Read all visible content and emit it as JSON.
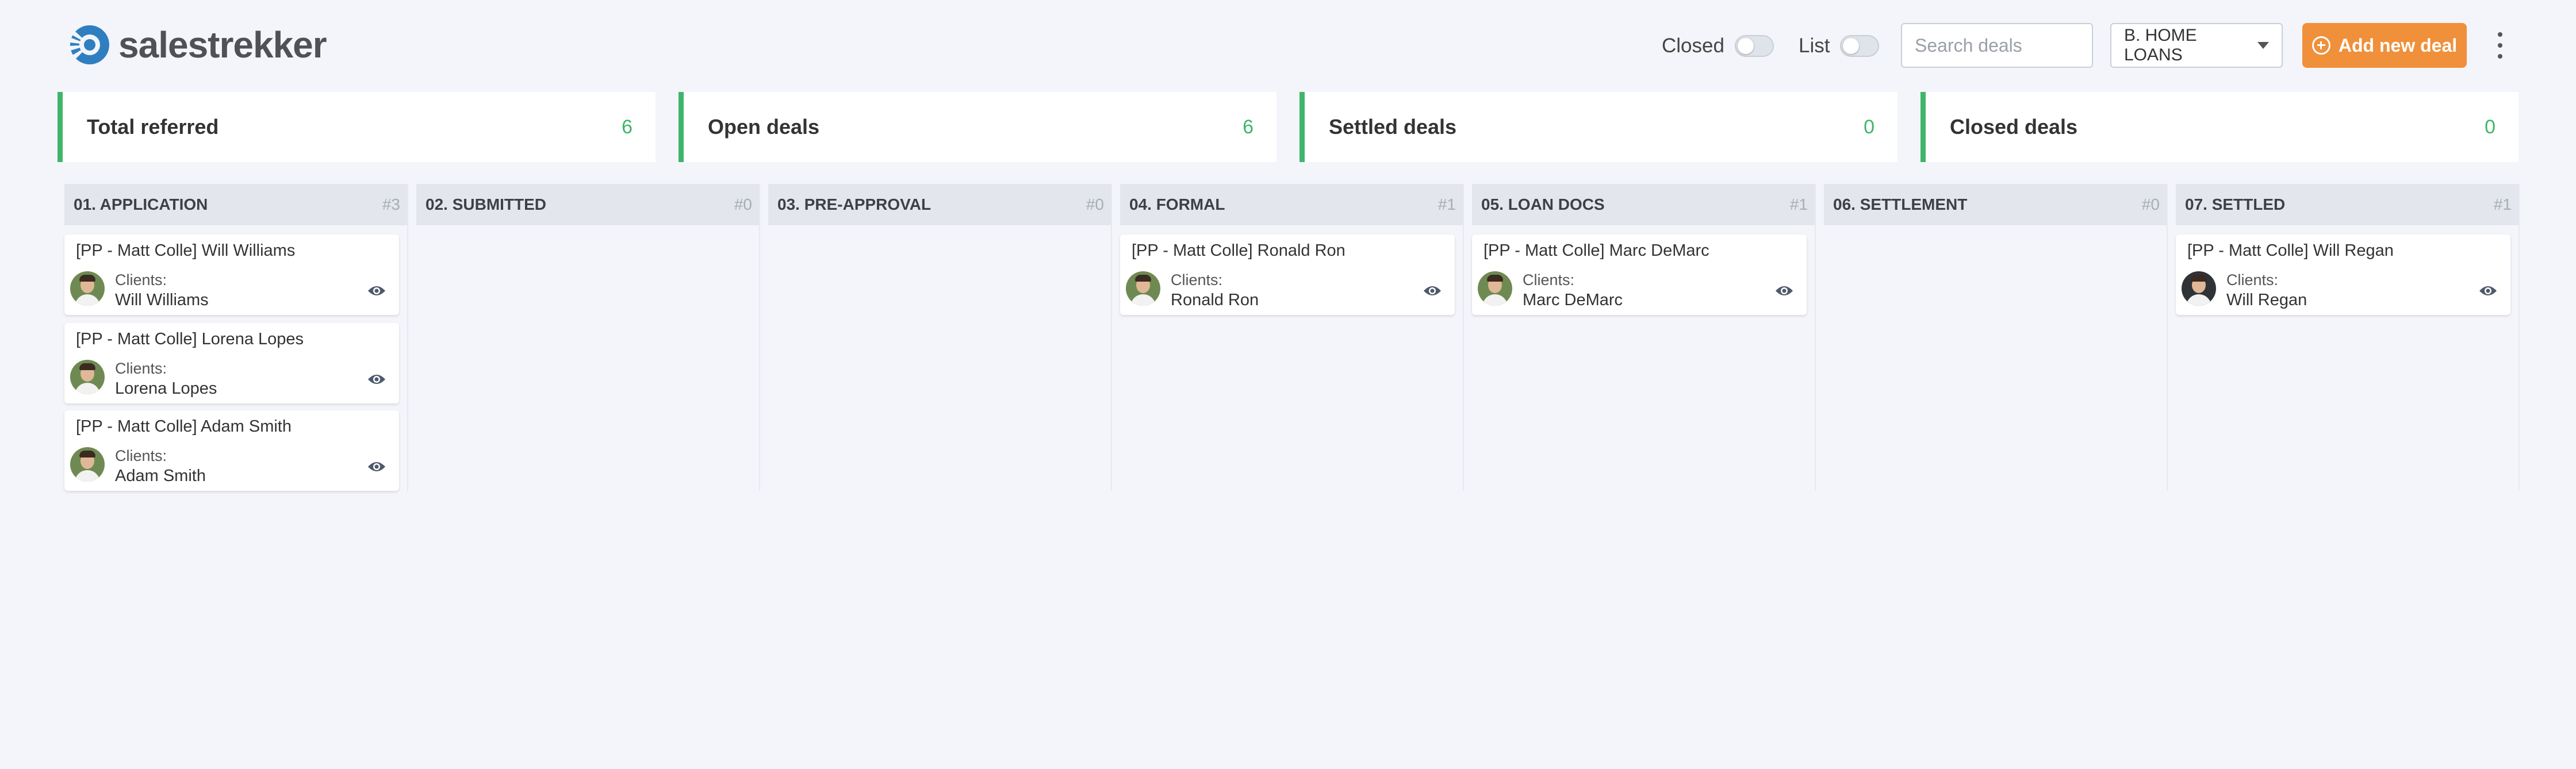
{
  "header": {
    "logo_text": "salestrekker",
    "closed_toggle": {
      "label": "Closed",
      "on": false
    },
    "list_toggle": {
      "label": "List",
      "on": false
    },
    "search": {
      "placeholder": "Search deals",
      "value": ""
    },
    "pipeline_select": {
      "value": "B. HOME LOANS"
    },
    "add_button_label": "Add new deal",
    "brand_color": "#f0903a"
  },
  "stats": [
    {
      "label": "Total referred",
      "value": "6"
    },
    {
      "label": "Open deals",
      "value": "6"
    },
    {
      "label": "Settled deals",
      "value": "0"
    },
    {
      "label": "Closed deals",
      "value": "0"
    }
  ],
  "columns": [
    {
      "title": "01. APPLICATION",
      "count": "#3",
      "deals": [
        {
          "title": "[PP - Matt Colle] Will Williams",
          "clients_label": "Clients:",
          "client": "Will Williams"
        },
        {
          "title": "[PP - Matt Colle] Lorena Lopes",
          "clients_label": "Clients:",
          "client": "Lorena Lopes"
        },
        {
          "title": "[PP - Matt Colle] Adam Smith",
          "clients_label": "Clients:",
          "client": "Adam Smith"
        }
      ]
    },
    {
      "title": "02. SUBMITTED",
      "count": "#0",
      "deals": []
    },
    {
      "title": "03. PRE-APPROVAL",
      "count": "#0",
      "deals": []
    },
    {
      "title": "04. FORMAL",
      "count": "#1",
      "deals": [
        {
          "title": "[PP - Matt Colle] Ronald Ron",
          "clients_label": "Clients:",
          "client": "Ronald Ron"
        }
      ]
    },
    {
      "title": "05. LOAN DOCS",
      "count": "#1",
      "deals": [
        {
          "title": "[PP - Matt Colle] Marc DeMarc",
          "clients_label": "Clients:",
          "client": "Marc DeMarc"
        }
      ]
    },
    {
      "title": "06. SETTLEMENT",
      "count": "#0",
      "deals": []
    },
    {
      "title": "07. SETTLED",
      "count": "#1",
      "deals": [
        {
          "title": "[PP - Matt Colle] Will Regan",
          "clients_label": "Clients:",
          "client": "Will Regan"
        }
      ]
    }
  ],
  "colors": {
    "accent_green": "#3fb56a",
    "accent_orange": "#f0903a",
    "logo_blue": "#2f7fc0"
  }
}
